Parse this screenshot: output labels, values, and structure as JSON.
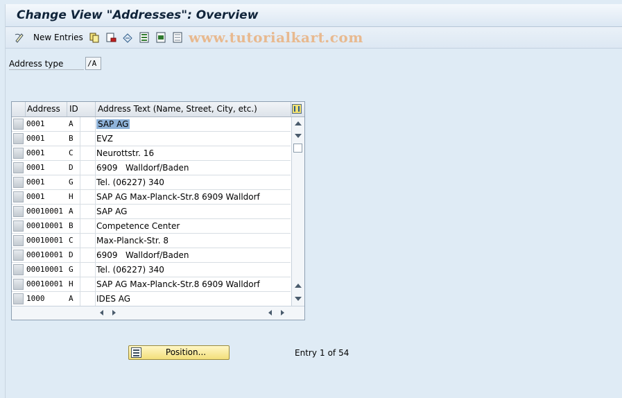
{
  "title": "Change View \"Addresses\": Overview",
  "toolbar": {
    "new_entries_label": "New Entries",
    "icons": [
      "edit-pen-icon",
      "copy-icon",
      "delete-icon",
      "undo-icon",
      "select-all-icon",
      "select-block-icon",
      "deselect-all-icon"
    ]
  },
  "watermark": "www.tutorialkart.com",
  "field": {
    "label": "Address type",
    "value": "/A"
  },
  "table": {
    "headers": [
      "Address",
      "ID",
      "Address Text (Name, Street, City, etc.)"
    ],
    "rows": [
      {
        "address": "0001",
        "id": "A",
        "text": "SAP AG"
      },
      {
        "address": "0001",
        "id": "B",
        "text": "EVZ"
      },
      {
        "address": "0001",
        "id": "C",
        "text": "Neurottstr. 16"
      },
      {
        "address": "0001",
        "id": "D",
        "text": "6909   Walldorf/Baden"
      },
      {
        "address": "0001",
        "id": "G",
        "text": "Tel. (06227) 340"
      },
      {
        "address": "0001",
        "id": "H",
        "text": "SAP AG Max-Planck-Str.8 6909 Walldorf"
      },
      {
        "address": "00010001",
        "id": "A",
        "text": "SAP AG"
      },
      {
        "address": "00010001",
        "id": "B",
        "text": "Competence Center"
      },
      {
        "address": "00010001",
        "id": "C",
        "text": "Max-Planck-Str. 8"
      },
      {
        "address": "00010001",
        "id": "D",
        "text": "6909   Walldorf/Baden"
      },
      {
        "address": "00010001",
        "id": "G",
        "text": "Tel. (06227) 340"
      },
      {
        "address": "00010001",
        "id": "H",
        "text": "SAP AG Max-Planck-Str.8 6909 Walldorf"
      },
      {
        "address": "1000",
        "id": "A",
        "text": "IDES AG"
      }
    ]
  },
  "position_button_label": "Position...",
  "entry": {
    "label": "Entry",
    "current": "1",
    "of_label": "of",
    "total": "54"
  },
  "colors": {
    "title_bg": "#dbe7f3",
    "page_bg": "#dfebf5",
    "highlight": "#8fb3d9",
    "button": "#f3df7a"
  }
}
